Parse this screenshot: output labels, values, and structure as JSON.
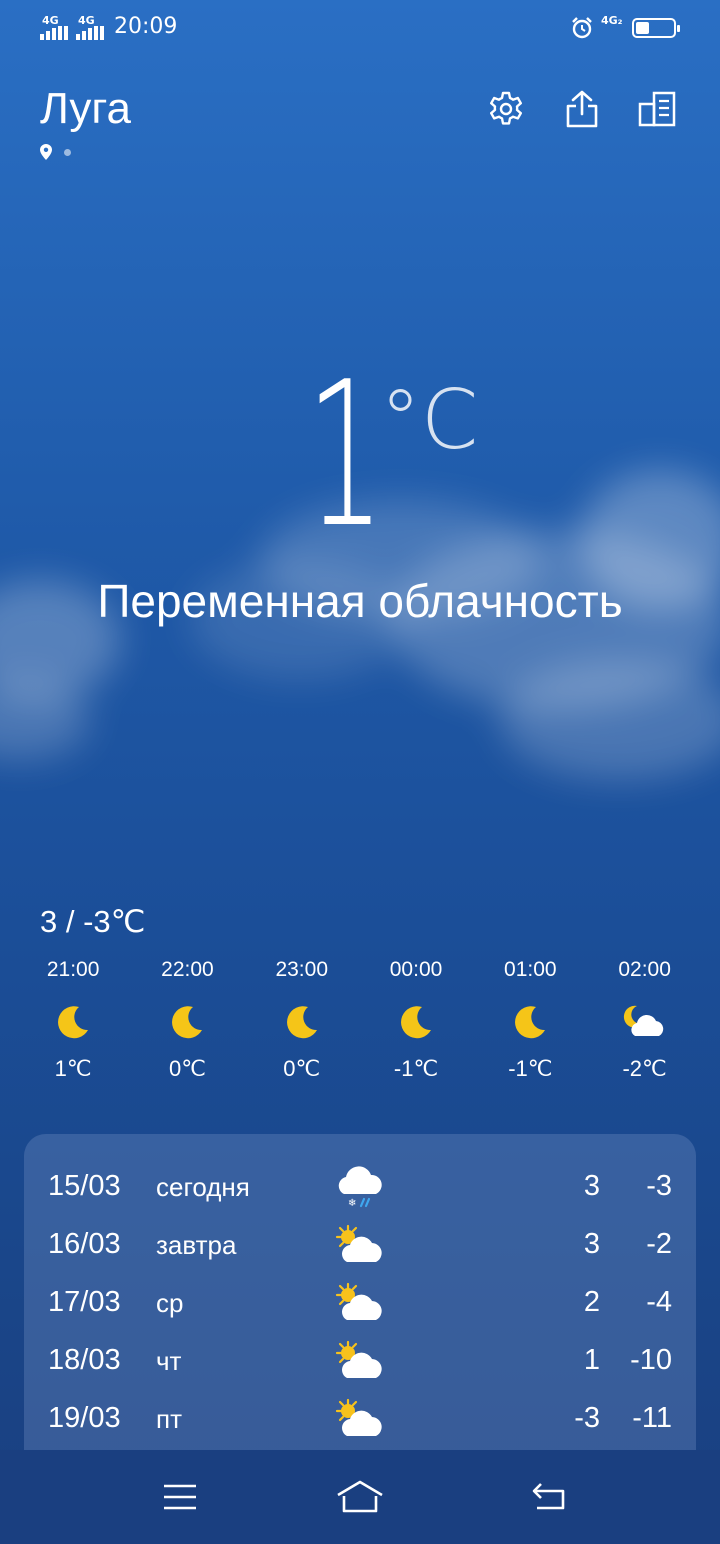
{
  "status_bar": {
    "sim1": "4G",
    "sim2": "4G",
    "time": "20:09",
    "net2": "4G₂",
    "battery_level": 0.35
  },
  "header": {
    "city": "Луга",
    "icons": [
      "location-pin-icon",
      "gear-icon",
      "share-icon",
      "city-list-icon"
    ]
  },
  "current": {
    "temp": "1",
    "unit": "°C",
    "condition": "Переменная облачность",
    "range": "3 / -3℃"
  },
  "hourly": [
    {
      "time": "21:00",
      "icon": "moon-icon",
      "temp": "1℃"
    },
    {
      "time": "22:00",
      "icon": "moon-icon",
      "temp": "0℃"
    },
    {
      "time": "23:00",
      "icon": "moon-icon",
      "temp": "0℃"
    },
    {
      "time": "00:00",
      "icon": "moon-icon",
      "temp": "-1℃"
    },
    {
      "time": "01:00",
      "icon": "moon-icon",
      "temp": "-1℃"
    },
    {
      "time": "02:00",
      "icon": "moon-cloud-icon",
      "temp": "-2℃"
    }
  ],
  "daily": [
    {
      "date": "15/03",
      "name": "сегодня",
      "icon": "cloud-snow-rain-icon",
      "hi": "3",
      "lo": "-3"
    },
    {
      "date": "16/03",
      "name": "завтра",
      "icon": "sun-cloud-icon",
      "hi": "3",
      "lo": "-2"
    },
    {
      "date": "17/03",
      "name": "ср",
      "icon": "sun-cloud-icon",
      "hi": "2",
      "lo": "-4"
    },
    {
      "date": "18/03",
      "name": "чт",
      "icon": "sun-cloud-icon",
      "hi": "1",
      "lo": "-10"
    },
    {
      "date": "19/03",
      "name": "пт",
      "icon": "sun-cloud-icon",
      "hi": "-3",
      "lo": "-11"
    }
  ],
  "navbar": {
    "icons": [
      "menu-icon",
      "home-icon",
      "back-icon"
    ]
  },
  "colors": {
    "sky_top": "#2a6fc4",
    "sky_bottom": "#193f80",
    "sun": "#f7c21c",
    "moon": "#f5c518"
  }
}
